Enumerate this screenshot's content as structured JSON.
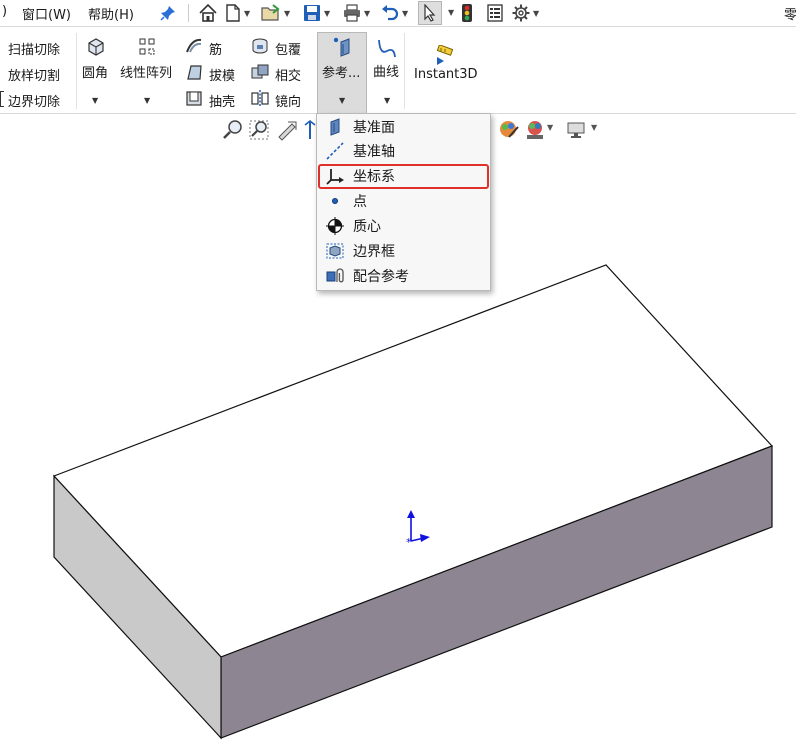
{
  "menubar": {
    "cut_fragment": ")",
    "window_menu": "窗口(W)",
    "help_menu": "帮助(H)",
    "right_fragment": "零"
  },
  "ribbon": {
    "sweep_cut": "扫描切除",
    "loft_cut": "放样切割",
    "boundary_cut": "边界切除",
    "fillet": "圆角",
    "linear_pattern": "线性阵列",
    "rib": "筋",
    "draft": "拔模",
    "shell": "抽壳",
    "wrap": "包覆",
    "intersect": "相交",
    "mirror": "镜向",
    "reference_geometry": "参考...",
    "curves": "曲线",
    "instant3d": "Instant3D"
  },
  "reference_menu": {
    "items": [
      {
        "label": "基准面",
        "icon": "plane-icon"
      },
      {
        "label": "基准轴",
        "icon": "axis-icon"
      },
      {
        "label": "坐标系",
        "icon": "coordinate-system-icon"
      },
      {
        "label": "点",
        "icon": "point-icon"
      },
      {
        "label": "质心",
        "icon": "center-of-mass-icon"
      },
      {
        "label": "边界框",
        "icon": "bounding-box-icon"
      },
      {
        "label": "配合参考",
        "icon": "mate-reference-icon"
      }
    ],
    "highlighted": "坐标系"
  },
  "colors": {
    "highlight_box": "#e0302a",
    "top_face": "#ffffff",
    "front_face": "#8d8692",
    "side_face": "#c9c9c9",
    "triad": "#1010e0"
  }
}
